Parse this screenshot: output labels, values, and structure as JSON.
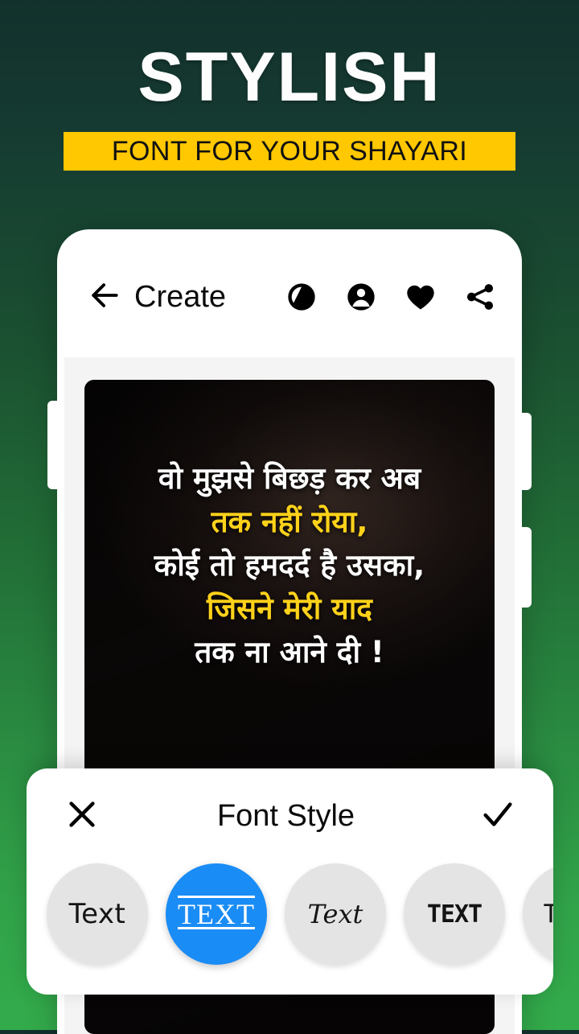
{
  "promo": {
    "title": "STYLISH",
    "subtitle": "FONT FOR YOUR SHAYARI",
    "title_color": "#ffffff",
    "subtitle_bg": "#ffc800",
    "subtitle_color": "#111111",
    "background_top": "#12312c",
    "background_bottom": "#33ab4b"
  },
  "app_bar": {
    "title": "Create",
    "back_icon": "arrow-left-icon",
    "actions": [
      {
        "icon": "contrast-icon",
        "name": "contrast-toggle"
      },
      {
        "icon": "account-circle-icon",
        "name": "account-button"
      },
      {
        "icon": "heart-icon",
        "name": "favorite-button"
      },
      {
        "icon": "share-icon",
        "name": "share-button"
      }
    ]
  },
  "editor": {
    "shayari_lines": [
      {
        "text": "वो मुझसे बिछड़ कर अब",
        "color": "#ffffff"
      },
      {
        "text": "तक नहीं रोया,",
        "color": "#ffd21a"
      },
      {
        "text": "कोई तो हमदर्द है उसका,",
        "color": "#ffffff"
      },
      {
        "text": "जिसने मेरी याद",
        "color": "#ffd21a"
      },
      {
        "text": "तक ना आने दी !",
        "color": "#ffffff"
      }
    ]
  },
  "font_panel": {
    "title": "Font Style",
    "close_icon": "close-icon",
    "done_icon": "check-icon",
    "selected_index": 1,
    "accent_color": "#1a8cf5",
    "chips": [
      {
        "label": "Text",
        "style": "chip-style-sans",
        "selected": false
      },
      {
        "label": "TEXT",
        "style": "chip-style-serif-ul",
        "selected": true
      },
      {
        "label": "Text",
        "style": "chip-style-script",
        "selected": false
      },
      {
        "label": "TEXT",
        "style": "chip-style-slab",
        "selected": false
      },
      {
        "label": "Text",
        "style": "chip-style-plain",
        "selected": false
      }
    ]
  }
}
